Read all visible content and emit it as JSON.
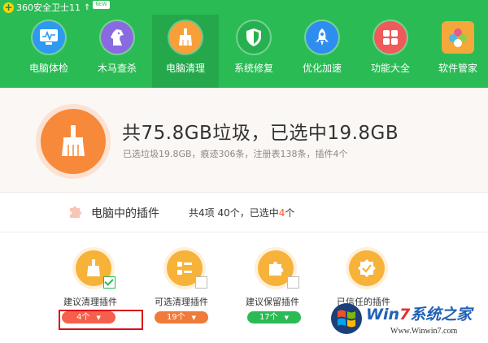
{
  "app": {
    "title": "360安全卫士11",
    "badge": "NEW"
  },
  "nav": [
    {
      "label": "电脑体检",
      "icon": "monitor-icon",
      "color": "#2d9af0"
    },
    {
      "label": "木马查杀",
      "icon": "horse-icon",
      "color": "#8a6ae0"
    },
    {
      "label": "电脑清理",
      "icon": "broom-icon",
      "color": "#f7a03a",
      "active": true
    },
    {
      "label": "系统修复",
      "icon": "shield-icon",
      "color": "#27b050"
    },
    {
      "label": "优化加速",
      "icon": "rocket-icon",
      "color": "#2e8ef0"
    },
    {
      "label": "功能大全",
      "icon": "grid-icon",
      "color": "#f05a5a"
    },
    {
      "label": "软件管家",
      "icon": "software-icon",
      "color": "#f4a83a"
    }
  ],
  "summary": {
    "title": "共75.8GB垃圾，已选中19.8GB",
    "subtitle": "已选垃圾19.8GB，痕迹306条，注册表138条，插件4个"
  },
  "plugins": {
    "title": "电脑中的插件",
    "stats_prefix": "共4项 40个，已选中",
    "stats_selected": "4",
    "stats_suffix": "个"
  },
  "categories": [
    {
      "label": "建议清理插件",
      "count": "4个",
      "checked": true,
      "pill_color": "#f4604c",
      "icon": "broom-icon"
    },
    {
      "label": "可选清理插件",
      "count": "19个",
      "checked": false,
      "pill_color": "#f07a3a",
      "icon": "list-icon"
    },
    {
      "label": "建议保留插件",
      "count": "17个",
      "checked": false,
      "pill_color": "#2bbb55",
      "icon": "puzzle-icon"
    },
    {
      "label": "已信任的插件",
      "count": "",
      "checked": false,
      "pill_color": "",
      "icon": "badge-check-icon"
    }
  ],
  "watermark": {
    "brand_prefix": "Win",
    "brand_seven": "7",
    "brand_suffix": "系统之家",
    "url": "Www.Winwin7.com"
  }
}
